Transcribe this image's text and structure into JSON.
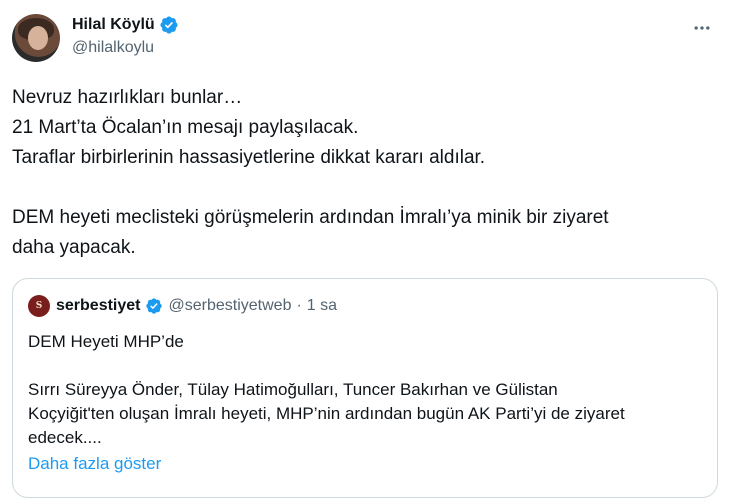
{
  "author": {
    "display_name": "Hilal Köylü",
    "handle": "@hilalkoylu"
  },
  "tweet": {
    "lines": [
      "Nevruz hazırlıkları bunlar…",
      "21 Mart’ta Öcalan’ın mesajı paylaşılacak.",
      "Taraflar birbirlerinin hassasiyetlerine dikkat kararı aldılar.",
      "DEM heyeti meclisteki görüşmelerin ardından İmralı’ya minik bir ziyaret",
      "daha yapacak."
    ]
  },
  "quoted": {
    "display_name": "serbestiyet",
    "handle": "@serbestiyetweb",
    "separator": "·",
    "time": "1 sa",
    "avatar_text": "S",
    "lines": [
      "DEM Heyeti MHP’de",
      "Sırrı Süreyya Önder, Tülay Hatimoğulları, Tuncer Bakırhan ve Gülistan",
      "Koçyiğit'ten oluşan İmralı heyeti, MHP’nin ardından bugün AK Parti’yi de ziyaret",
      "edecek...."
    ],
    "show_more": "Daha fazla göster"
  },
  "icons": {
    "verified_color": "#1d9bf0",
    "more": "more-icon"
  }
}
